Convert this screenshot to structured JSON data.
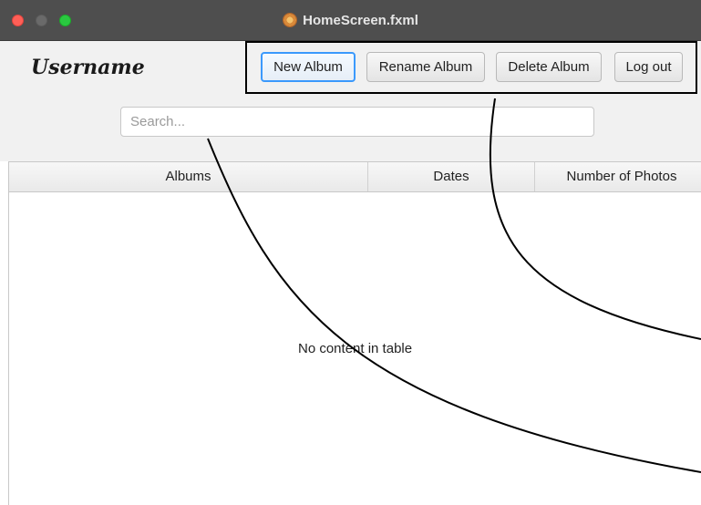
{
  "window": {
    "title": "HomeScreen.fxml",
    "icon": "app-icon"
  },
  "header": {
    "username": "Username"
  },
  "toolbar": {
    "new_album_label": "New Album",
    "rename_album_label": "Rename Album",
    "delete_album_label": "Delete Album",
    "logout_label": "Log out"
  },
  "search": {
    "placeholder": "Search...",
    "value": ""
  },
  "table": {
    "columns": [
      "Albums",
      "Dates",
      "Number of Photos"
    ],
    "empty_message": "No content in table"
  },
  "colors": {
    "titlebar": "#4e4e4e",
    "focus_accent": "#3b99fc",
    "close": "#fe5f57",
    "maximize": "#2ac840"
  }
}
